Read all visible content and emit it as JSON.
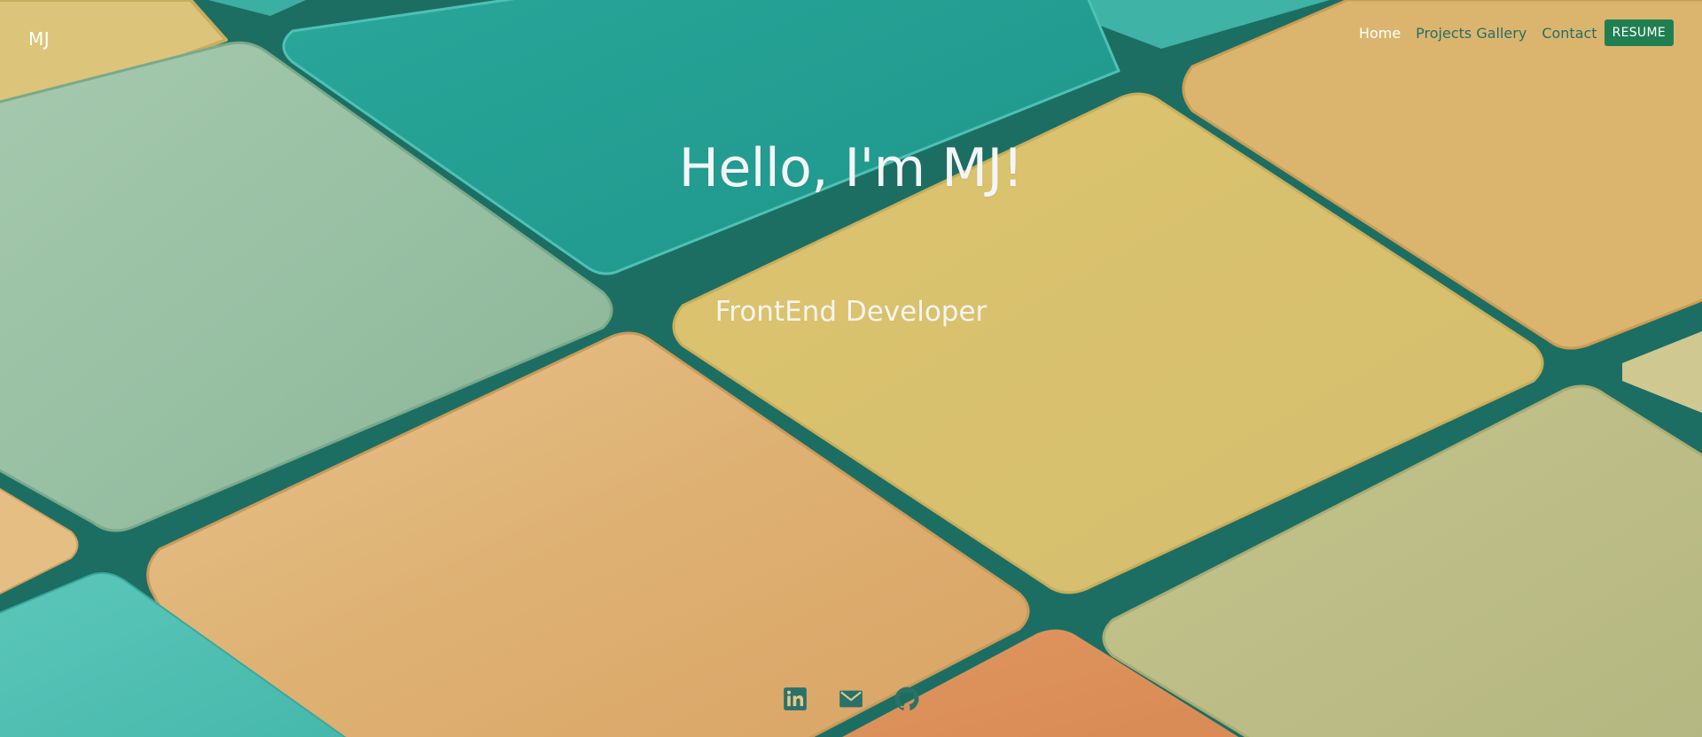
{
  "header": {
    "logo": "MJ",
    "nav": [
      {
        "label": "Home",
        "active": true
      },
      {
        "label": "Projects Gallery",
        "active": false
      },
      {
        "label": "Contact",
        "active": false
      }
    ],
    "resume_label": "RESUME"
  },
  "hero": {
    "title": "Hello, I'm MJ!",
    "subtitle": "FrontEnd Developer"
  },
  "socials": [
    {
      "icon": "linkedin-icon"
    },
    {
      "icon": "mail-icon"
    },
    {
      "icon": "github-icon"
    }
  ],
  "colors": {
    "nav_link": "#256e66",
    "nav_active": "#ffffff",
    "resume_button": "#1f7f51",
    "social_icons": "#2a7169",
    "teal": "#25a396",
    "sage": "#95bea0",
    "yellow": "#d6c16e",
    "peach": "#deb074",
    "olive": "#bcbe88"
  }
}
